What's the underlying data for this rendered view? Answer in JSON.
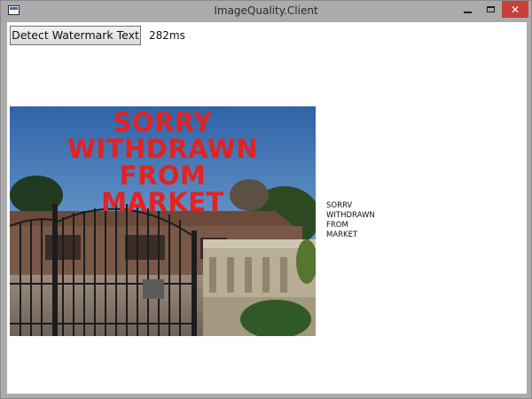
{
  "window": {
    "title": "ImageQuality.Client",
    "icon": "app-window-icon",
    "controls": {
      "minimize": "minimize-icon",
      "maximize": "maximize-icon",
      "close": "close-icon",
      "close_glyph": "✕",
      "close_color": "#c7403a"
    }
  },
  "toolbar": {
    "detect_button_label": "Detect Watermark Text",
    "elapsed": "282ms"
  },
  "image": {
    "watermark_lines": [
      "SORRY",
      "WITHDRAWN",
      "FROM",
      "MARKET"
    ],
    "watermark_color": "#e32222"
  },
  "ocr_result": {
    "lines": [
      "SORRV",
      "WITHDRAWN",
      "FROM",
      "MARKET"
    ]
  }
}
